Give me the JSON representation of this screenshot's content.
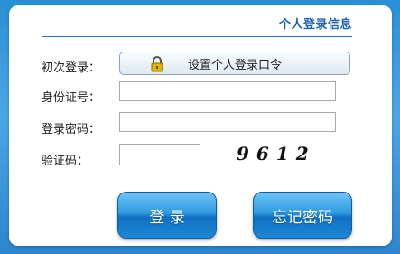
{
  "header": {
    "title": "个人登录信息"
  },
  "form": {
    "first_login_label": "初次登录：",
    "set_password_button": "设置个人登录口令",
    "id_label": "身份证号：",
    "id_value": "",
    "password_label": "登录密码：",
    "password_value": "",
    "captcha_label": "验证码：",
    "captcha_value": "",
    "captcha_text": "9612"
  },
  "buttons": {
    "login": "登 录",
    "forgot": "忘记密码"
  },
  "icons": {
    "lock": "lock-icon"
  }
}
